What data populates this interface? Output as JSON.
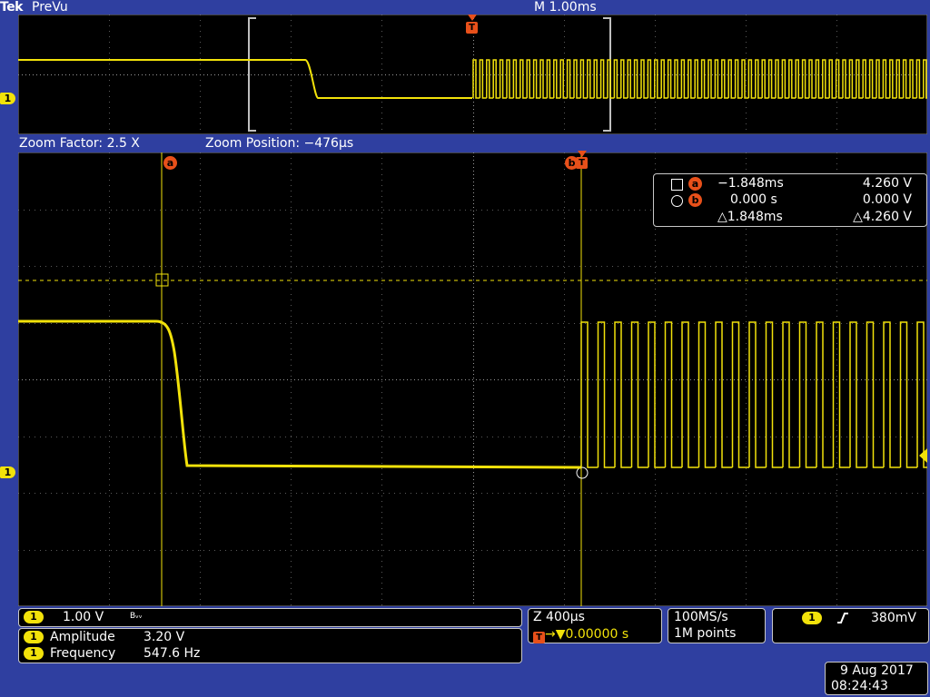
{
  "header": {
    "brand": "Tek",
    "mode": "PreVu",
    "timebase": "M 1.00ms"
  },
  "zoom": {
    "factor": "Zoom Factor: 2.5 X",
    "position": "Zoom Position: −476µs"
  },
  "markers": {
    "channel": "1",
    "trigger": "T",
    "cursor_a": "a",
    "cursor_b": "b"
  },
  "cursor_readout": {
    "row_a": {
      "time": "−1.848ms",
      "volts": "4.260 V"
    },
    "row_b": {
      "time": "0.000 s",
      "volts": "0.000 V"
    },
    "delta": {
      "time": "△1.848ms",
      "volts": "△4.260 V"
    }
  },
  "channel_box": {
    "channel": "1",
    "scale": "1.00 V",
    "bw_flag": "Bᵥᵥ"
  },
  "measurements": [
    {
      "channel": "1",
      "name": "Amplitude",
      "value": "3.20 V"
    },
    {
      "channel": "1",
      "name": "Frequency",
      "value": "547.6 Hz"
    }
  ],
  "horizontal": {
    "zoom_scale": "Z 400µs",
    "trigger_glyph": "T",
    "trigger_position": "→▼0.00000 s"
  },
  "acquisition": {
    "sample_rate": "100MS/s",
    "record_length": "1M points"
  },
  "trigger_box": {
    "channel": "1",
    "slope": "rising-edge-icon",
    "level": "380mV"
  },
  "datetime": {
    "date": "9 Aug 2017",
    "time": "08:24:43"
  },
  "colors": {
    "background": "#2f3fa0",
    "trace": "#f2e20a",
    "cursor_tag": "#e8501a",
    "screen": "#000000"
  }
}
